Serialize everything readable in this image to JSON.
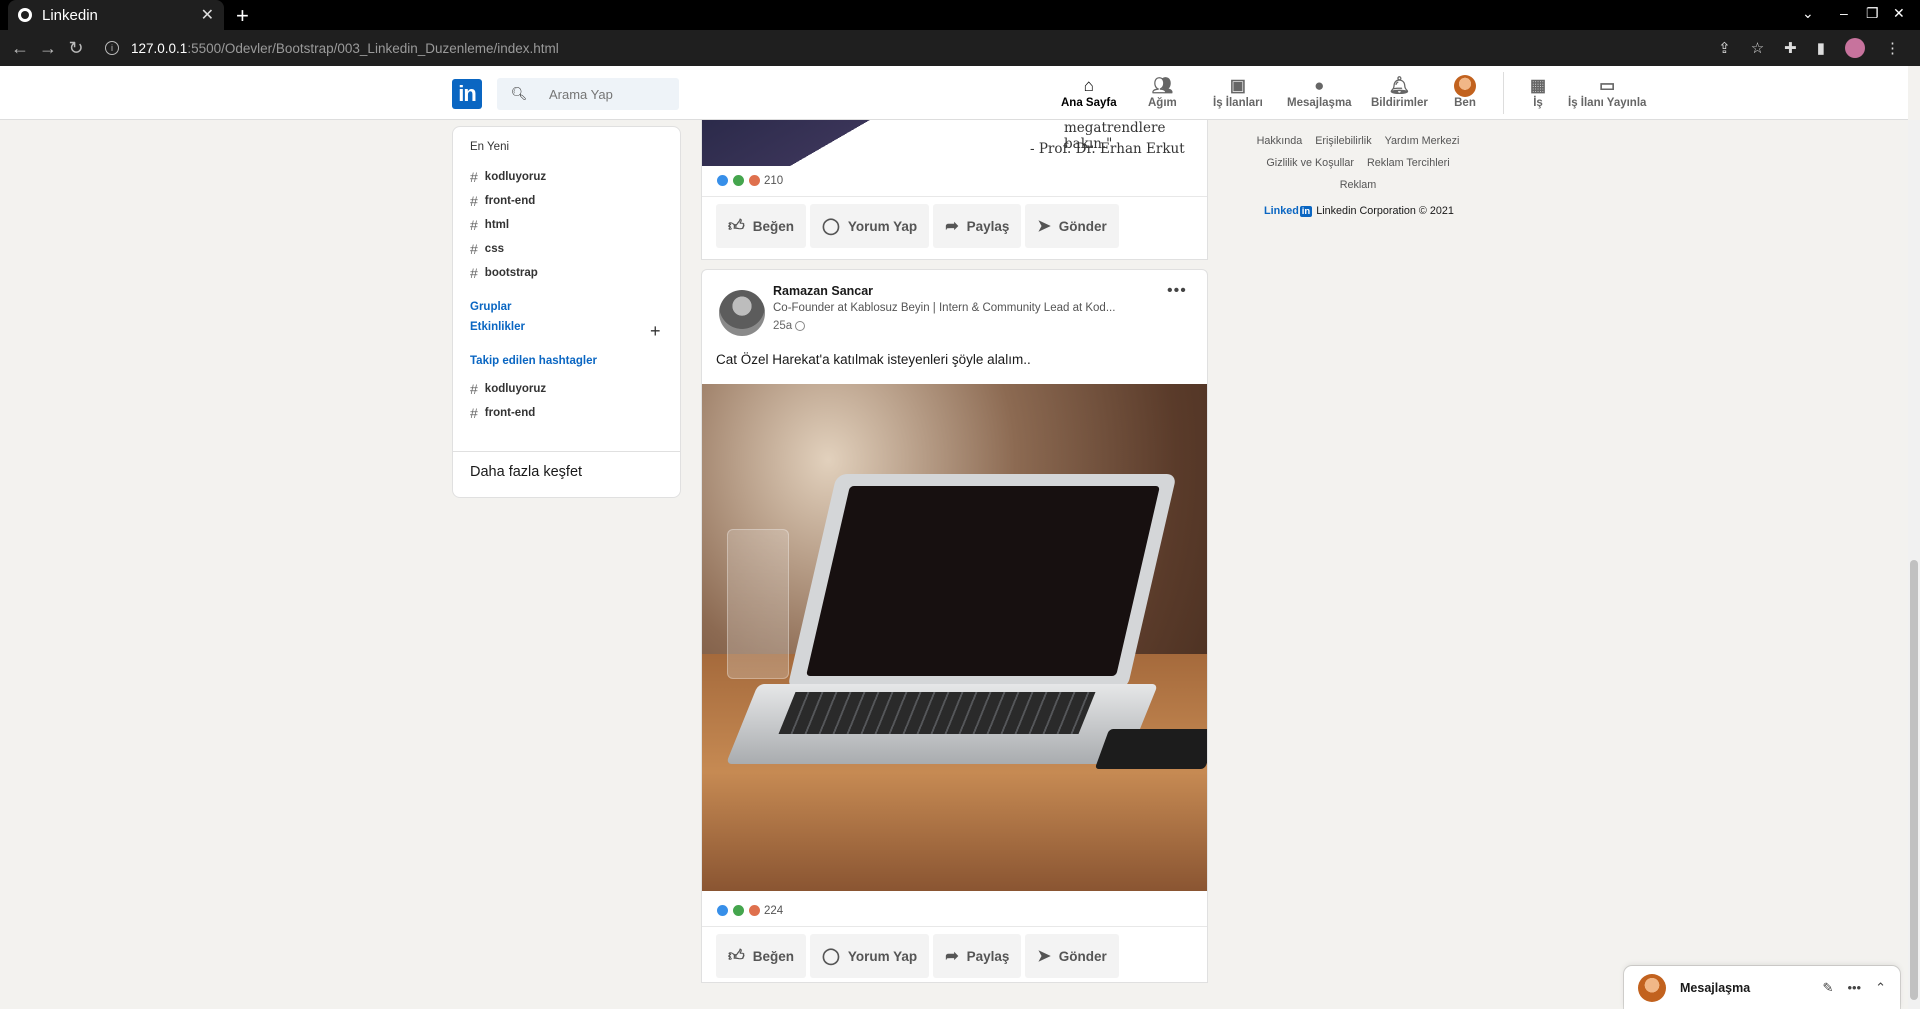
{
  "browser": {
    "tab_title": "Linkedin",
    "url_host": "127.0.0.1",
    "url_path": ":5500/Odevler/Bootstrap/003_Linkedin_Duzenleme/index.html"
  },
  "header": {
    "logo": "in",
    "search_placeholder": "Arama Yap",
    "nav": [
      {
        "label": "Ana Sayfa",
        "icon": "home-icon"
      },
      {
        "label": "Ağım",
        "icon": "network-icon"
      },
      {
        "label": "İş İlanları",
        "icon": "briefcase-icon"
      },
      {
        "label": "Mesajlaşma",
        "icon": "message-icon"
      },
      {
        "label": "Bildirimler",
        "icon": "bell-icon"
      },
      {
        "label": "Ben",
        "icon": "avatar"
      },
      {
        "label": "İş",
        "icon": "grid-icon"
      },
      {
        "label": "İş İlanı Yayınla",
        "icon": "laptop-icon"
      }
    ]
  },
  "sidebar": {
    "recent_title": "En Yeni",
    "recent_tags": [
      "kodluyoruz",
      "front-end",
      "html",
      "css",
      "bootstrap"
    ],
    "groups": "Gruplar",
    "events": "Etkinlikler",
    "followed_title": "Takip edilen hashtagler",
    "followed_tags": [
      "kodluyoruz",
      "front-end"
    ],
    "discover_more": "Daha fazla keşfet"
  },
  "post1": {
    "quote_line1": "megatrendlere bakın.\"",
    "quote_line2": "- Prof. Dr. Erhan Erkut",
    "reaction_count": "210"
  },
  "actions": {
    "like": "Beğen",
    "comment": "Yorum Yap",
    "share": "Paylaş",
    "send": "Gönder"
  },
  "post2": {
    "author": "Ramazan Sancar",
    "headline": "Co-Founder at Kablosuz Beyin | Intern & Community Lead at Kod...",
    "time": "25a",
    "text": "Cat Özel Harekat'a katılmak isteyenleri şöyle alalım..",
    "reaction_count": "224"
  },
  "footer": {
    "links_row1": [
      "Hakkında",
      "Erişilebilirlik",
      "Yardım Merkezi"
    ],
    "links_row2": [
      "Gizlilik ve Koşullar",
      "Reklam Tercihleri"
    ],
    "links_row3": [
      "Reklam"
    ],
    "brand_word": "Linked",
    "brand_box": "in",
    "copyright": "Linkedin Corporation © 2021"
  },
  "messaging": {
    "title": "Mesajlaşma"
  }
}
